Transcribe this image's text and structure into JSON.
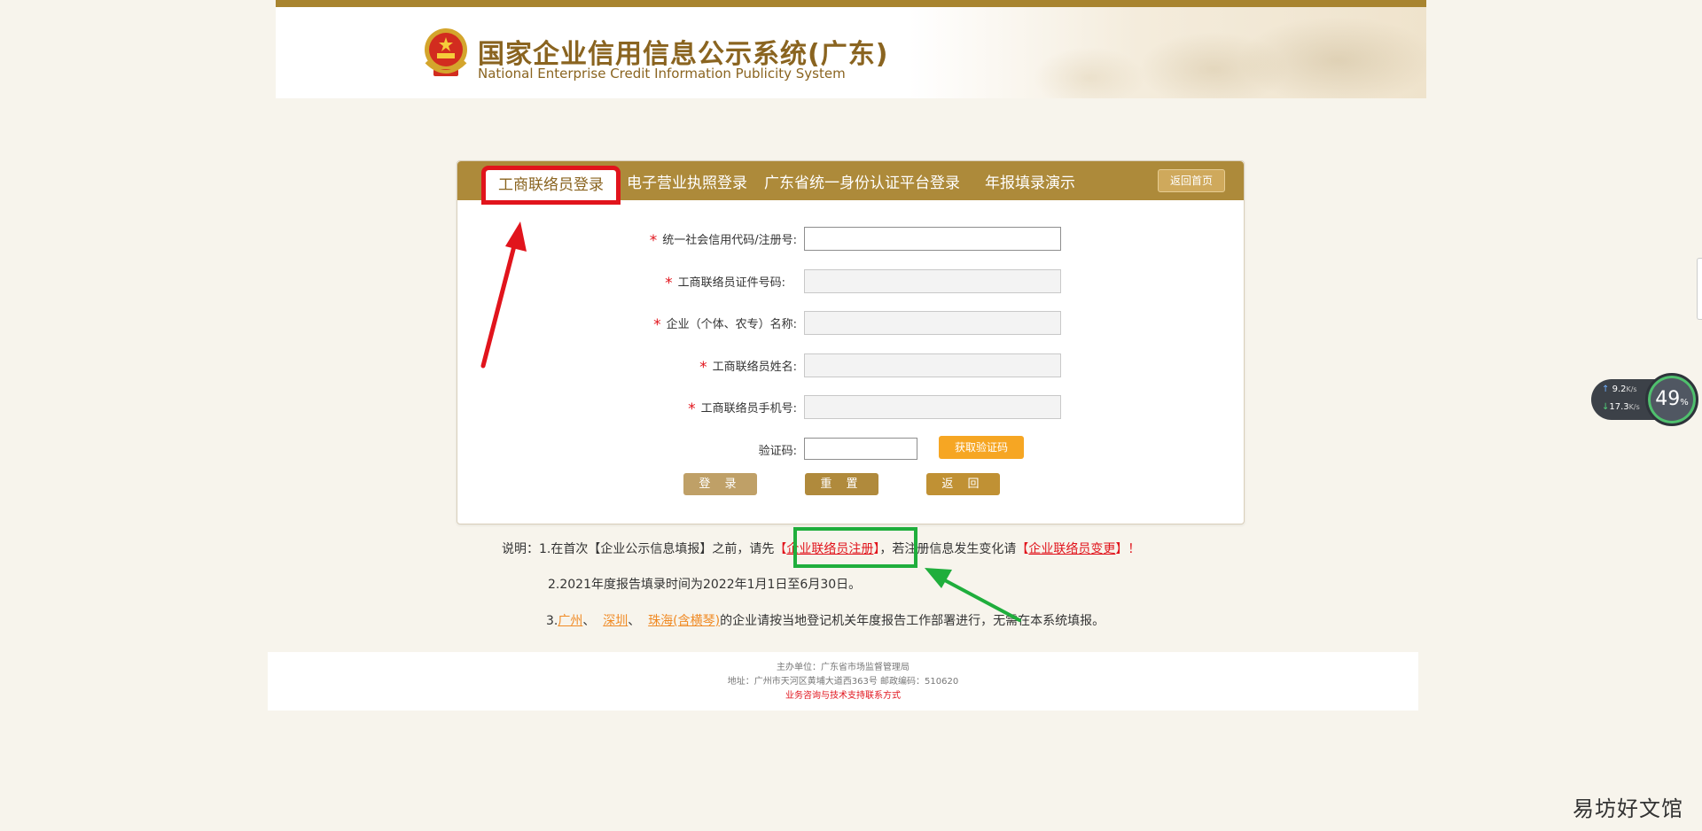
{
  "header": {
    "title": "国家企业信用信息公示系统(广东)",
    "subtitle": "National Enterprise Credit Information Publicity System"
  },
  "tabs": [
    {
      "label": "工商联络员登录",
      "active": true
    },
    {
      "label": "电子营业执照登录",
      "active": false
    },
    {
      "label": "广东省统一身份认证平台登录",
      "active": false
    },
    {
      "label": "年报填录演示",
      "active": false
    }
  ],
  "home_button": "返回首页",
  "form": {
    "fields": [
      {
        "label": "统一社会信用代码/注册号:",
        "required": true,
        "value": ""
      },
      {
        "label": "工商联络员证件号码:",
        "required": true,
        "value": ""
      },
      {
        "label": "企业（个体、农专）名称:",
        "required": true,
        "value": ""
      },
      {
        "label": "工商联络员姓名:",
        "required": true,
        "value": ""
      },
      {
        "label": "工商联络员手机号:",
        "required": true,
        "value": ""
      }
    ],
    "required_mark": "*",
    "captcha_label": "验证码:",
    "captcha_button": "获取验证码",
    "login_button": "登 录",
    "reset_button": "重 置",
    "back_button": "返 回"
  },
  "notes": {
    "line1_prefix": "说明：1.在首次【企业公示信息填报】之前，请先",
    "line1_link_open": "【",
    "line1_link": "企业联络员注册",
    "line1_link_close": "】",
    "line1_middle": "，若注册信息发生变化请",
    "line1_link2_open": "【",
    "line1_link2": "企业联络员变更",
    "line1_link2_close": "】！",
    "line2": "2.2021年度报告填录时间为2022年1月1日至6月30日。",
    "line3_prefix": "3.",
    "city1": "广州",
    "sep1": "、",
    "city2": "深圳",
    "sep2": "、",
    "city3": "珠海(含横琴)",
    "line3_suffix": "的企业请按当地登记机关年度报告工作部署进行，无需在本系统填报。"
  },
  "footer": {
    "sponsor": "主办单位：广东省市场监督管理局",
    "address": "地址：广州市天河区黄埔大道西363号    邮政编码：510620",
    "contact": "业务咨询与技术支持联系方式"
  },
  "net_widget": {
    "upload": "9.2",
    "upload_unit": "K/s",
    "download": "17.3",
    "download_unit": "K/s",
    "percent": "49",
    "percent_unit": "%"
  },
  "watermark": "易坊好文馆",
  "colors": {
    "gold": "#ad8a3a",
    "highlight_red": "#e1141c",
    "highlight_green": "#1fae3c",
    "captcha_orange": "#f6a623"
  }
}
